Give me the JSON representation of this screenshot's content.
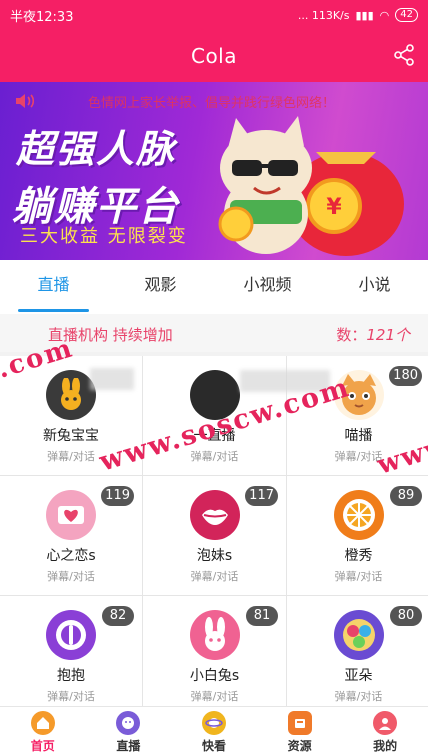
{
  "status_bar": {
    "time": "半夜12:33",
    "network": "... 113K/s",
    "battery": "42"
  },
  "header": {
    "title": "Cola"
  },
  "banner": {
    "notice": "色情网上家长举报、倡导并践行绿色网络！",
    "headline_1": "超强人脉",
    "headline_2": "躺赚平台",
    "tagline": "三大收益  无限裂变",
    "coin_symbol": "¥"
  },
  "tabs": [
    {
      "label": "直播",
      "active": true
    },
    {
      "label": "观影",
      "active": false
    },
    {
      "label": "小视频",
      "active": false
    },
    {
      "label": "小说",
      "active": false
    }
  ],
  "info_bar": {
    "left": "直播机构 持续增加",
    "right_prefix": "数：",
    "right_count": "121个"
  },
  "platforms": [
    {
      "name": "新兔宝宝",
      "sub": "弹幕/对话",
      "count": "",
      "icon": "rabbit-icon",
      "color": "#3a3a3a"
    },
    {
      "name": "一直播",
      "sub": "弹幕/对话",
      "count": "",
      "icon": "live-icon",
      "color": "#2a2a2a"
    },
    {
      "name": "喵播",
      "sub": "弹幕/对话",
      "count": "180",
      "icon": "cat-icon",
      "color": "#f0a34a"
    },
    {
      "name": "心之恋s",
      "sub": "弹幕/对话",
      "count": "119",
      "icon": "heart-icon",
      "color": "#f4a4c0"
    },
    {
      "name": "泡妹s",
      "sub": "弹幕/对话",
      "count": "117",
      "icon": "lips-icon",
      "color": "#d2245a"
    },
    {
      "name": "橙秀",
      "sub": "弹幕/对话",
      "count": "89",
      "icon": "orange-icon",
      "color": "#f07d1a"
    },
    {
      "name": "抱抱",
      "sub": "弹幕/对话",
      "count": "82",
      "icon": "mic-icon",
      "color": "#8a3fd6"
    },
    {
      "name": "小白兔s",
      "sub": "弹幕/对话",
      "count": "81",
      "icon": "bunny-icon",
      "color": "#f06292"
    },
    {
      "name": "亚朵",
      "sub": "弹幕/对话",
      "count": "80",
      "icon": "flower-icon",
      "color": "#6a4bd2"
    }
  ],
  "watermark": {
    "line1": ".com",
    "line2": "www.soscw.com",
    "line3": "www."
  },
  "bottom_nav": [
    {
      "label": "首页",
      "icon": "home-icon",
      "color": "#f59a2a",
      "active": true
    },
    {
      "label": "直播",
      "icon": "live-face-icon",
      "color": "#7a5cd8",
      "active": false
    },
    {
      "label": "快看",
      "icon": "planet-icon",
      "color": "#f0b51e",
      "active": false
    },
    {
      "label": "资源",
      "icon": "resource-icon",
      "color": "#f07a2a",
      "active": false
    },
    {
      "label": "我的",
      "icon": "user-icon",
      "color": "#f05a6a",
      "active": false
    }
  ]
}
